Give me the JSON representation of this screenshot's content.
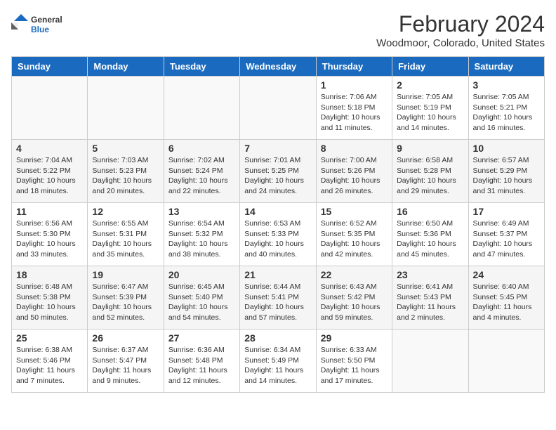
{
  "header": {
    "logo_general": "General",
    "logo_blue": "Blue",
    "month_title": "February 2024",
    "location": "Woodmoor, Colorado, United States"
  },
  "days_of_week": [
    "Sunday",
    "Monday",
    "Tuesday",
    "Wednesday",
    "Thursday",
    "Friday",
    "Saturday"
  ],
  "weeks": [
    [
      {
        "day": "",
        "info": ""
      },
      {
        "day": "",
        "info": ""
      },
      {
        "day": "",
        "info": ""
      },
      {
        "day": "",
        "info": ""
      },
      {
        "day": "1",
        "info": "Sunrise: 7:06 AM\nSunset: 5:18 PM\nDaylight: 10 hours\nand 11 minutes."
      },
      {
        "day": "2",
        "info": "Sunrise: 7:05 AM\nSunset: 5:19 PM\nDaylight: 10 hours\nand 14 minutes."
      },
      {
        "day": "3",
        "info": "Sunrise: 7:05 AM\nSunset: 5:21 PM\nDaylight: 10 hours\nand 16 minutes."
      }
    ],
    [
      {
        "day": "4",
        "info": "Sunrise: 7:04 AM\nSunset: 5:22 PM\nDaylight: 10 hours\nand 18 minutes."
      },
      {
        "day": "5",
        "info": "Sunrise: 7:03 AM\nSunset: 5:23 PM\nDaylight: 10 hours\nand 20 minutes."
      },
      {
        "day": "6",
        "info": "Sunrise: 7:02 AM\nSunset: 5:24 PM\nDaylight: 10 hours\nand 22 minutes."
      },
      {
        "day": "7",
        "info": "Sunrise: 7:01 AM\nSunset: 5:25 PM\nDaylight: 10 hours\nand 24 minutes."
      },
      {
        "day": "8",
        "info": "Sunrise: 7:00 AM\nSunset: 5:26 PM\nDaylight: 10 hours\nand 26 minutes."
      },
      {
        "day": "9",
        "info": "Sunrise: 6:58 AM\nSunset: 5:28 PM\nDaylight: 10 hours\nand 29 minutes."
      },
      {
        "day": "10",
        "info": "Sunrise: 6:57 AM\nSunset: 5:29 PM\nDaylight: 10 hours\nand 31 minutes."
      }
    ],
    [
      {
        "day": "11",
        "info": "Sunrise: 6:56 AM\nSunset: 5:30 PM\nDaylight: 10 hours\nand 33 minutes."
      },
      {
        "day": "12",
        "info": "Sunrise: 6:55 AM\nSunset: 5:31 PM\nDaylight: 10 hours\nand 35 minutes."
      },
      {
        "day": "13",
        "info": "Sunrise: 6:54 AM\nSunset: 5:32 PM\nDaylight: 10 hours\nand 38 minutes."
      },
      {
        "day": "14",
        "info": "Sunrise: 6:53 AM\nSunset: 5:33 PM\nDaylight: 10 hours\nand 40 minutes."
      },
      {
        "day": "15",
        "info": "Sunrise: 6:52 AM\nSunset: 5:35 PM\nDaylight: 10 hours\nand 42 minutes."
      },
      {
        "day": "16",
        "info": "Sunrise: 6:50 AM\nSunset: 5:36 PM\nDaylight: 10 hours\nand 45 minutes."
      },
      {
        "day": "17",
        "info": "Sunrise: 6:49 AM\nSunset: 5:37 PM\nDaylight: 10 hours\nand 47 minutes."
      }
    ],
    [
      {
        "day": "18",
        "info": "Sunrise: 6:48 AM\nSunset: 5:38 PM\nDaylight: 10 hours\nand 50 minutes."
      },
      {
        "day": "19",
        "info": "Sunrise: 6:47 AM\nSunset: 5:39 PM\nDaylight: 10 hours\nand 52 minutes."
      },
      {
        "day": "20",
        "info": "Sunrise: 6:45 AM\nSunset: 5:40 PM\nDaylight: 10 hours\nand 54 minutes."
      },
      {
        "day": "21",
        "info": "Sunrise: 6:44 AM\nSunset: 5:41 PM\nDaylight: 10 hours\nand 57 minutes."
      },
      {
        "day": "22",
        "info": "Sunrise: 6:43 AM\nSunset: 5:42 PM\nDaylight: 10 hours\nand 59 minutes."
      },
      {
        "day": "23",
        "info": "Sunrise: 6:41 AM\nSunset: 5:43 PM\nDaylight: 11 hours\nand 2 minutes."
      },
      {
        "day": "24",
        "info": "Sunrise: 6:40 AM\nSunset: 5:45 PM\nDaylight: 11 hours\nand 4 minutes."
      }
    ],
    [
      {
        "day": "25",
        "info": "Sunrise: 6:38 AM\nSunset: 5:46 PM\nDaylight: 11 hours\nand 7 minutes."
      },
      {
        "day": "26",
        "info": "Sunrise: 6:37 AM\nSunset: 5:47 PM\nDaylight: 11 hours\nand 9 minutes."
      },
      {
        "day": "27",
        "info": "Sunrise: 6:36 AM\nSunset: 5:48 PM\nDaylight: 11 hours\nand 12 minutes."
      },
      {
        "day": "28",
        "info": "Sunrise: 6:34 AM\nSunset: 5:49 PM\nDaylight: 11 hours\nand 14 minutes."
      },
      {
        "day": "29",
        "info": "Sunrise: 6:33 AM\nSunset: 5:50 PM\nDaylight: 11 hours\nand 17 minutes."
      },
      {
        "day": "",
        "info": ""
      },
      {
        "day": "",
        "info": ""
      }
    ]
  ]
}
